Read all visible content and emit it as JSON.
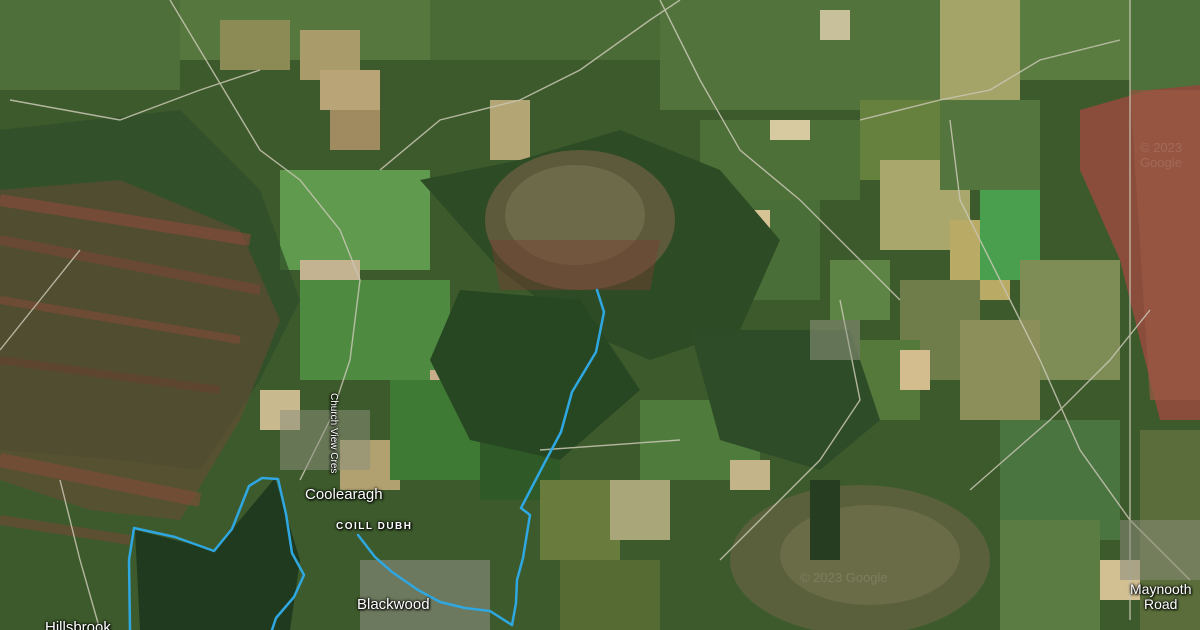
{
  "map": {
    "type": "satellite",
    "route_color": "#2fa7e0",
    "labels": {
      "coolearagh": "Coolearagh",
      "coill_dubh": "COILL DUBH",
      "blackwood": "Blackwood",
      "maynooth_road_line1": "Maynooth",
      "maynooth_road_line2": "Road",
      "church_view_cres": "Church View Cres",
      "hillsbrook": "Hillsbrook"
    },
    "watermarks": [
      "© 2023 Google",
      "© 2023 Google"
    ]
  }
}
